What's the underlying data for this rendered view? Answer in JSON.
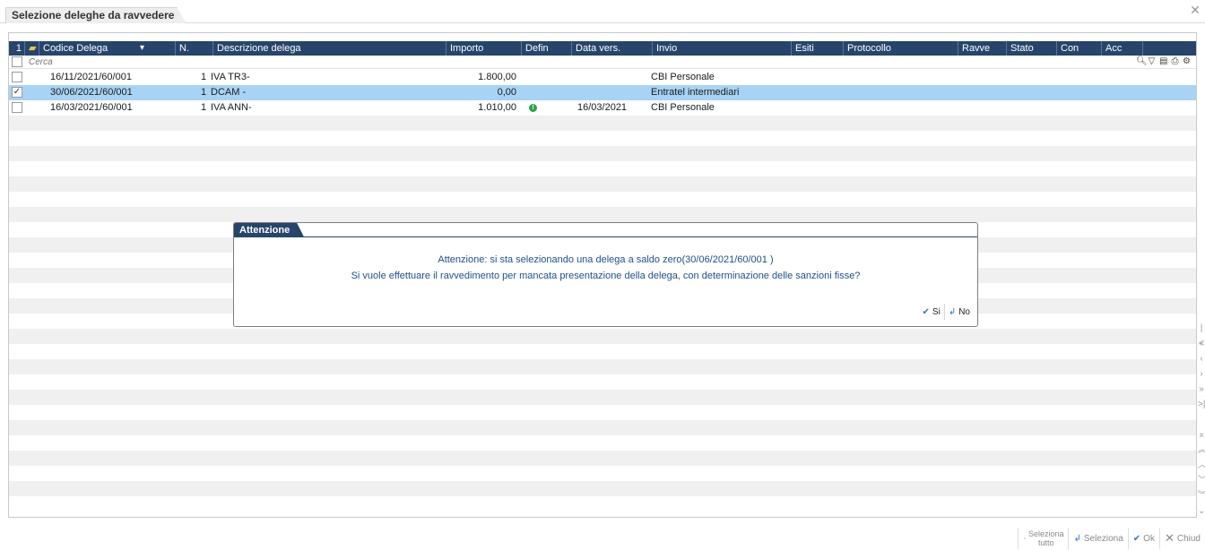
{
  "window": {
    "title": "Selezione deleghe da ravvedere",
    "close_glyph": "✕"
  },
  "grid": {
    "columns": [
      {
        "key": "num",
        "label": "1"
      },
      {
        "key": "folder",
        "label": ""
      },
      {
        "key": "codice",
        "label": "Codice Delega"
      },
      {
        "key": "n",
        "label": "N."
      },
      {
        "key": "descr",
        "label": "Descrizione delega"
      },
      {
        "key": "importo",
        "label": "Importo"
      },
      {
        "key": "defin",
        "label": "Defin"
      },
      {
        "key": "datavers",
        "label": "Data vers."
      },
      {
        "key": "invio",
        "label": "Invio"
      },
      {
        "key": "esiti",
        "label": "Esiti"
      },
      {
        "key": "protocollo",
        "label": "Protocollo"
      },
      {
        "key": "ravve",
        "label": "Ravve"
      },
      {
        "key": "stato",
        "label": "Stato"
      },
      {
        "key": "con",
        "label": "Con"
      },
      {
        "key": "acc",
        "label": "Acc"
      }
    ],
    "search_placeholder": "Cerca",
    "rows": [
      {
        "checked": false,
        "selected": false,
        "codice": "16/11/2021/60/001",
        "n": "1",
        "descr": "IVA TR3-",
        "importo": "1.800,00",
        "defin_dot": false,
        "datavers": "",
        "invio": "CBI Personale"
      },
      {
        "checked": true,
        "selected": true,
        "codice": "30/06/2021/60/001",
        "n": "1",
        "descr": "DCAM -",
        "importo": "0,00",
        "defin_dot": false,
        "datavers": "",
        "invio": "Entratel intermediari"
      },
      {
        "checked": false,
        "selected": false,
        "codice": "16/03/2021/60/001",
        "n": "1",
        "descr": "IVA ANN-",
        "importo": "1.010,00",
        "defin_dot": true,
        "datavers": "16/03/2021",
        "invio": "CBI Personale"
      }
    ],
    "empty_rows": 26,
    "tool_icons": [
      "search-icon",
      "filter-icon",
      "export-icon",
      "print-icon",
      "settings-icon"
    ]
  },
  "dialog": {
    "title": "Attenzione",
    "message_line1": "Attenzione: si sta selezionando una delega a saldo zero(30/06/2021/60/001 )",
    "message_line2": "Si vuole effettuare il ravvedimento per mancata presentazione della delega, con determinazione delle sanzioni fisse?",
    "yes_label": "Si",
    "no_label": "No"
  },
  "footer": {
    "select_all_line1": "Seleziona",
    "select_all_line2": "tutto",
    "select_label": "Seleziona",
    "ok_label": "Ok",
    "close_label": "Chiud"
  },
  "colors": {
    "header_bg": "#27456b",
    "selected_row": "#a8d3f5",
    "dialog_text": "#1f4e8c",
    "defin_dot": "#2da24a"
  }
}
